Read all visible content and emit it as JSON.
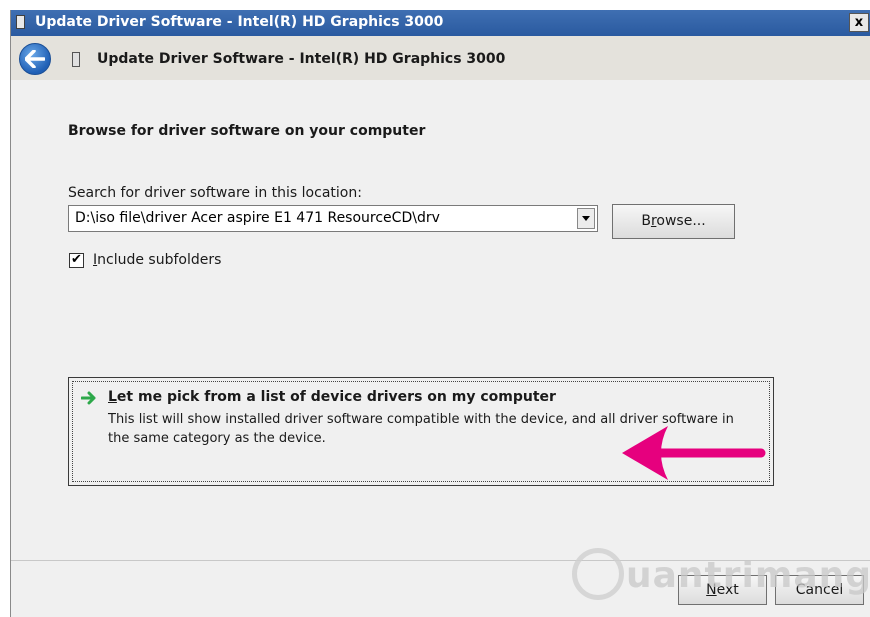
{
  "window": {
    "title": "Update Driver Software - Intel(R) HD Graphics 3000",
    "close_glyph": "x"
  },
  "header": {
    "title": "Update Driver Software - Intel(R) HD Graphics 3000"
  },
  "main": {
    "heading": "Browse for driver software on your computer",
    "search_label": "Search for driver software in this location:",
    "path_value": "D:\\iso file\\driver Acer aspire E1 471 ResourceCD\\drv",
    "browse_prefix": "B",
    "browse_accel": "r",
    "browse_suffix": "owse...",
    "include_subfolders": {
      "checked": true,
      "accel": "I",
      "rest": "nclude subfolders"
    },
    "pick_option": {
      "title_accel": "L",
      "title_rest": "et me pick from a list of device drivers on my computer",
      "description": "This list will show installed driver software compatible with the device, and all driver software in the same category as the device."
    }
  },
  "footer": {
    "next_accel": "N",
    "next_rest": "ext",
    "cancel_label": "Cancel"
  },
  "watermark": {
    "text": "uantrimang"
  },
  "colors": {
    "title_bar": "#2f62a8",
    "highlight_arrow": "#e6007e",
    "option_arrow": "#2da84a"
  }
}
